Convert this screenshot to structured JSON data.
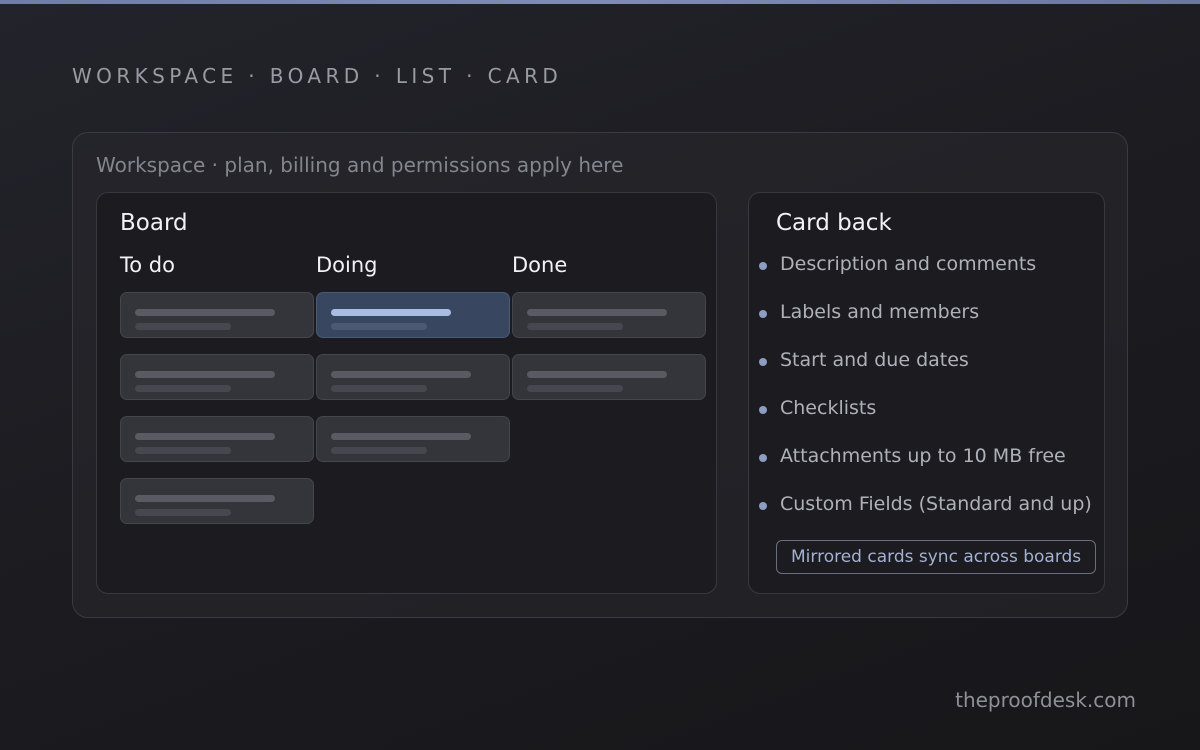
{
  "eyebrow": "WORKSPACE · BOARD · LIST · CARD",
  "workspace": {
    "caption": "Workspace · plan, billing and permissions apply here"
  },
  "board": {
    "title": "Board",
    "lists": [
      {
        "title": "To do",
        "card_count": 4
      },
      {
        "title": "Doing",
        "card_count": 3,
        "highlighted_card": 1
      },
      {
        "title": "Done",
        "card_count": 2
      }
    ]
  },
  "card_back": {
    "title": "Card back",
    "features": [
      "Description and comments",
      "Labels and members",
      "Start and due dates",
      "Checklists",
      "Attachments up to 10 MB free",
      "Custom Fields (Standard and up)"
    ],
    "note": "Mirrored cards sync across boards"
  },
  "footer": "theproofdesk.com",
  "colors": {
    "accent": "#8c9cc3",
    "highlight_card": "#38475f",
    "card": "#34343b"
  }
}
